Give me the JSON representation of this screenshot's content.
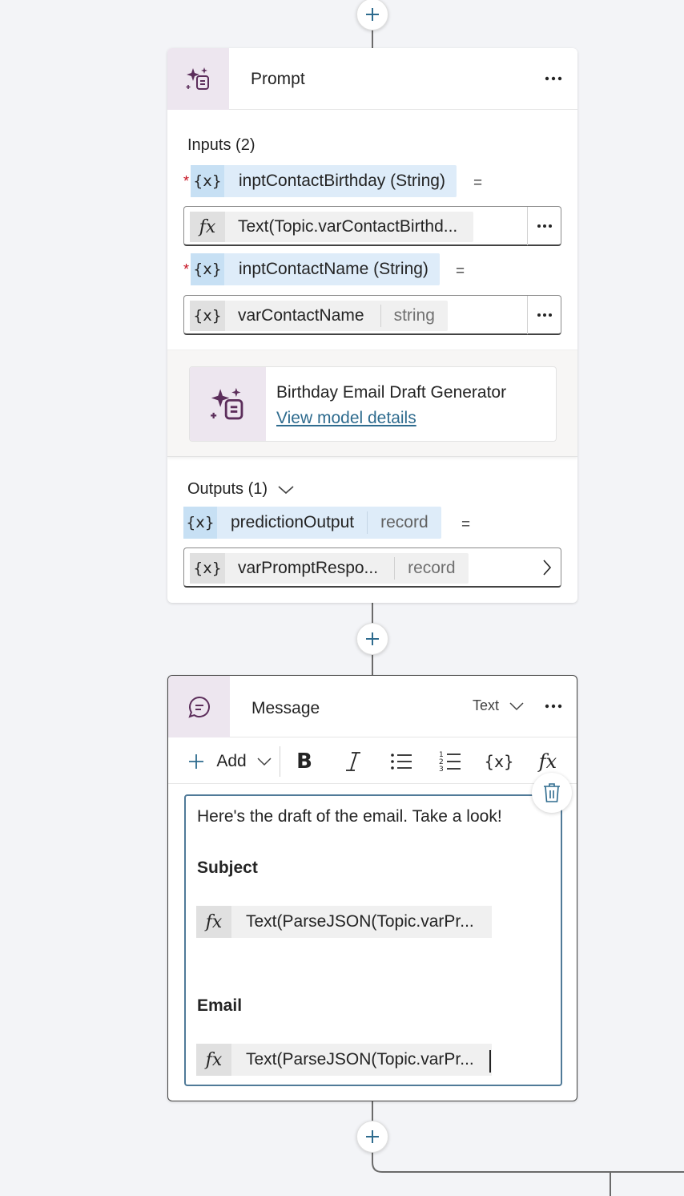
{
  "prompt_node": {
    "title": "Prompt",
    "inputs_label": "Inputs (2)",
    "inputs": [
      {
        "name": "inptContactBirthday (String)",
        "equals": "=",
        "value_kind": "formula",
        "value": "Text(Topic.varContactBirthd...",
        "value_type": ""
      },
      {
        "name": "inptContactName (String)",
        "equals": "=",
        "value_kind": "variable",
        "value": "varContactName",
        "value_type": "string"
      }
    ],
    "model": {
      "name": "Birthday Email Draft Generator",
      "link": "View model details"
    },
    "outputs_label": "Outputs (1)",
    "output": {
      "name": "predictionOutput",
      "type": "record",
      "equals": "=",
      "target": "varPromptRespo...",
      "target_type": "record"
    }
  },
  "message_node": {
    "title": "Message",
    "format_label": "Text",
    "toolbar": {
      "add_label": "Add"
    },
    "editor": {
      "intro": "Here's the draft of the email. Take a look!",
      "subject_heading": "Subject",
      "subject_formula": "Text(ParseJSON(Topic.varPr...",
      "email_heading": "Email",
      "email_formula": "Text(ParseJSON(Topic.varPr..."
    }
  },
  "symbols": {
    "variable": "{x}",
    "required": "*"
  },
  "colors": {
    "accent": "#2e6b8e",
    "variable_chip": "#deecf9",
    "node_icon_bg": "#ede6ef",
    "copilot_purple": "#5c2e5b",
    "required": "#c50f1f"
  }
}
